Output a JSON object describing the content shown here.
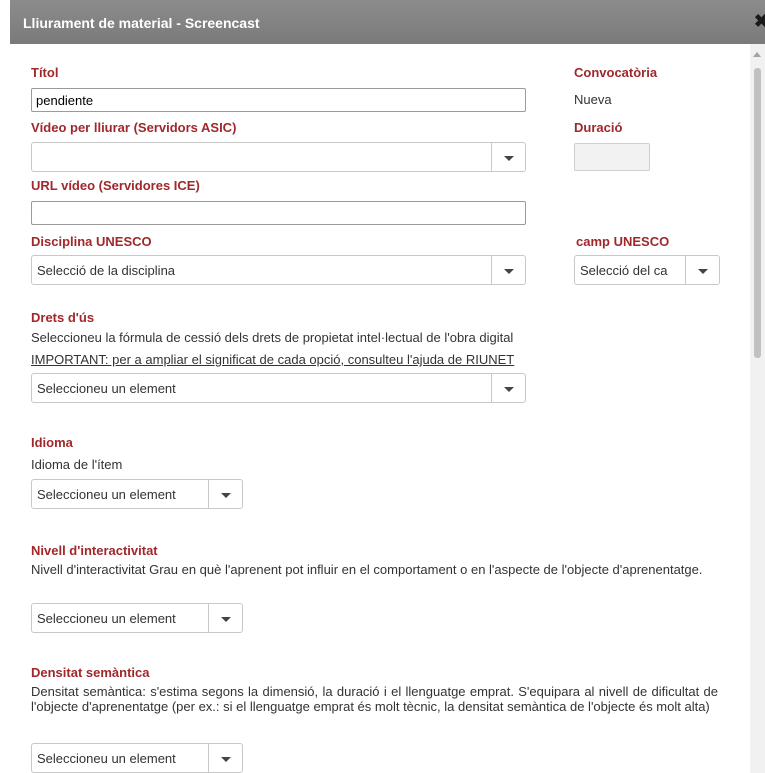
{
  "dialog": {
    "title": "Lliurament de material - Screencast",
    "close_glyph": "✖"
  },
  "fields": {
    "titol": {
      "label": "Títol",
      "value": "pendiente"
    },
    "convocatoria": {
      "label": "Convocatòria",
      "value": "Nueva"
    },
    "video": {
      "label": "Vídeo per lliurar (Servidors ASIC)",
      "value": ""
    },
    "duracio": {
      "label": "Duració",
      "value": ""
    },
    "url": {
      "label": "URL vídeo (Servidores ICE)",
      "value": ""
    },
    "disciplina": {
      "label": "Disciplina UNESCO",
      "value": "Selecció de la disciplina"
    },
    "camp": {
      "label": "camp UNESCO",
      "value": "Selecció del ca"
    },
    "drets": {
      "label": "Drets d'ús",
      "description": "Seleccioneu la fórmula de cessió dels drets de propietat intel·lectual de l'obra digital",
      "link": "IMPORTANT: per a ampliar el significat de cada opció, consulteu l'ajuda de RIUNET",
      "value": "Seleccioneu un element"
    },
    "idioma": {
      "label": "Idioma",
      "description": "Idioma de l'ítem",
      "value": "Seleccioneu un element"
    },
    "interactivitat": {
      "label": "Nivell d'interactivitat",
      "description": "Nivell d'interactivitat Grau en què l'aprenent pot influir en el comportament o en l'aspecte de l'objecte d'aprenentatge.",
      "value": "Seleccioneu un element"
    },
    "densitat": {
      "label": "Densitat semàntica",
      "description": "Densitat semàntica: s'estima segons la dimensió, la duració i el llenguatge emprat. S'equipara al nivell de dificultat de l'objecte d'aprenentatge (per ex.: si el llenguatge emprat és molt tècnic, la densitat semàntica de l'objecte és molt alta)",
      "value": "Seleccioneu un element"
    }
  },
  "colors": {
    "label": "#a0282b",
    "titlebar": "#808080"
  },
  "icons": {
    "caret": "caret-down-icon",
    "close": "close-icon"
  }
}
